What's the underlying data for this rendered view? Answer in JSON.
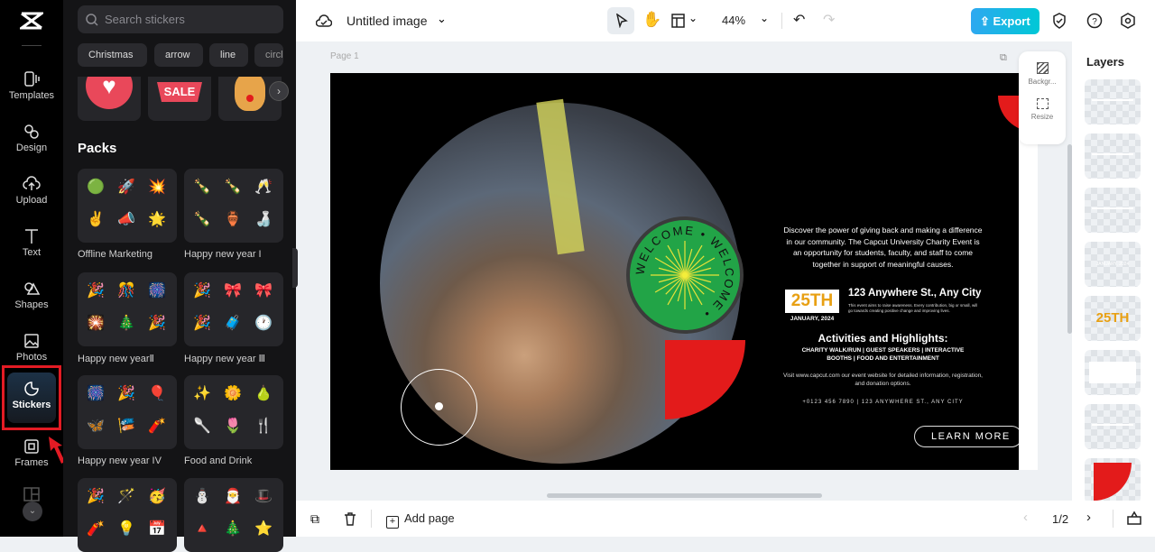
{
  "rail": {
    "items": [
      {
        "label": "Templates",
        "icon": "templates-icon"
      },
      {
        "label": "Design",
        "icon": "design-icon"
      },
      {
        "label": "Upload",
        "icon": "upload-icon"
      },
      {
        "label": "Text",
        "icon": "text-icon"
      },
      {
        "label": "Shapes",
        "icon": "shapes-icon"
      },
      {
        "label": "Photos",
        "icon": "photos-icon"
      },
      {
        "label": "Stickers",
        "icon": "stickers-icon",
        "active": true
      },
      {
        "label": "Frames",
        "icon": "frames-icon"
      }
    ]
  },
  "panel": {
    "search_placeholder": "Search stickers",
    "chips": [
      "Christmas",
      "arrow",
      "line",
      "circle"
    ],
    "stickers": [
      "heart",
      "SALE",
      "reindeer"
    ],
    "packs_heading": "Packs",
    "packs": [
      {
        "label": "Offline Marketing"
      },
      {
        "label": "Happy new year I"
      },
      {
        "label": "Happy new yearⅡ"
      },
      {
        "label": "Happy new year Ⅲ"
      },
      {
        "label": "Happy new year IV"
      },
      {
        "label": "Food and Drink"
      },
      {
        "label": ""
      },
      {
        "label": ""
      }
    ]
  },
  "toolbar": {
    "title": "Untitled image",
    "zoom": "44%",
    "export": "Export"
  },
  "canvas": {
    "page_label": "Page 1",
    "float": {
      "background": "Backgr...",
      "resize": "Resize"
    }
  },
  "design": {
    "badge_text": "WELCOME",
    "intro": "Discover the power of giving back and making a difference in our community. The Capcut University Charity Event is an opportunity for students, faculty, and staff to come together in support of meaningful causes.",
    "date_big": "25TH",
    "date_small": "JANUARY, 2024",
    "address": "123 Anywhere St., Any City",
    "small_text": "This event aims to raise awareness. Every contribution, big or small, will go towards creating positive change and improving lives.",
    "activities_title": "Activities and Highlights:",
    "activities": "CHARITY WALK/RUN | GUEST SPEAKERS | INTERACTIVE BOOTHS | FOOD AND ENTERTAINMENT",
    "visit": "Visit www.capcut.com our event website for detailed information, registration, and donation options.",
    "contact": "+0123 456 7890 | 123 ANYWHERE ST., ANY CITY",
    "cta": "LEARN MORE",
    "colors": {
      "red": "#e31b1b",
      "green": "#22a447",
      "orange": "#e8a013"
    }
  },
  "layers": {
    "title": "Layers",
    "items": [
      "text",
      "text",
      "text",
      "JANUARY, 2024",
      "25TH",
      "white box",
      "text",
      "red shape"
    ]
  },
  "bottom": {
    "add_page": "Add page",
    "pagination": "1/2"
  },
  "colors": {
    "accent": "#00c4cc",
    "highlight_box": "#e31b24"
  }
}
